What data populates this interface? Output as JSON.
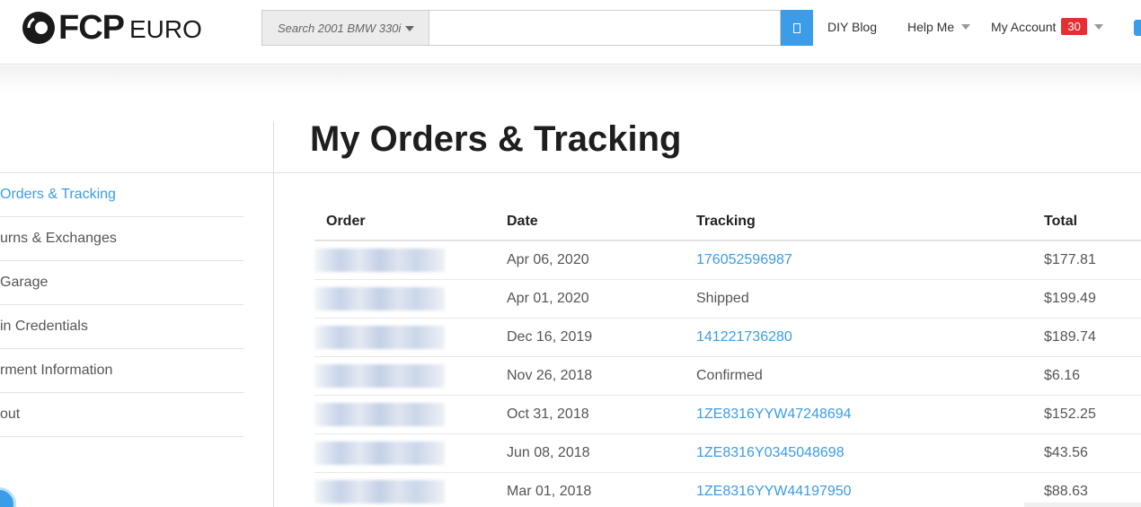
{
  "header": {
    "logo": {
      "fcp": "FCP",
      "euro": "EURO"
    },
    "search": {
      "vehicle_label": "Search 2001 BMW 330i",
      "placeholder": ""
    },
    "nav": {
      "diy_blog": "DIY Blog",
      "help_me": "Help Me",
      "my_account": "My Account",
      "account_badge": "30"
    }
  },
  "sidebar": {
    "items": [
      {
        "label": "Orders & Tracking",
        "active": true
      },
      {
        "label": "urns & Exchanges",
        "active": false
      },
      {
        "label": "Garage",
        "active": false
      },
      {
        "label": "in Credentials",
        "active": false
      },
      {
        "label": "rment Information",
        "active": false
      },
      {
        "label": "out",
        "active": false
      }
    ]
  },
  "main": {
    "title": "My Orders & Tracking",
    "columns": {
      "order": "Order",
      "date": "Date",
      "tracking": "Tracking",
      "total": "Total"
    },
    "orders": [
      {
        "date": "Apr 06, 2020",
        "tracking": "176052596987",
        "tracking_is_link": true,
        "total": "$177.81"
      },
      {
        "date": "Apr 01, 2020",
        "tracking": "Shipped",
        "tracking_is_link": false,
        "total": "$199.49"
      },
      {
        "date": "Dec 16, 2019",
        "tracking": "141221736280",
        "tracking_is_link": true,
        "total": "$189.74"
      },
      {
        "date": "Nov 26, 2018",
        "tracking": "Confirmed",
        "tracking_is_link": false,
        "total": "$6.16"
      },
      {
        "date": "Oct 31, 2018",
        "tracking": "1ZE8316YYW47248694",
        "tracking_is_link": true,
        "total": "$152.25"
      },
      {
        "date": "Jun 08, 2018",
        "tracking": "1ZE8316Y0345048698",
        "tracking_is_link": true,
        "total": "$43.56"
      },
      {
        "date": "Mar 01, 2018",
        "tracking": "1ZE8316YYW44197950",
        "tracking_is_link": true,
        "total": "$88.63"
      }
    ]
  },
  "colors": {
    "accent": "#3b9ce8",
    "badge": "#e42f35"
  }
}
